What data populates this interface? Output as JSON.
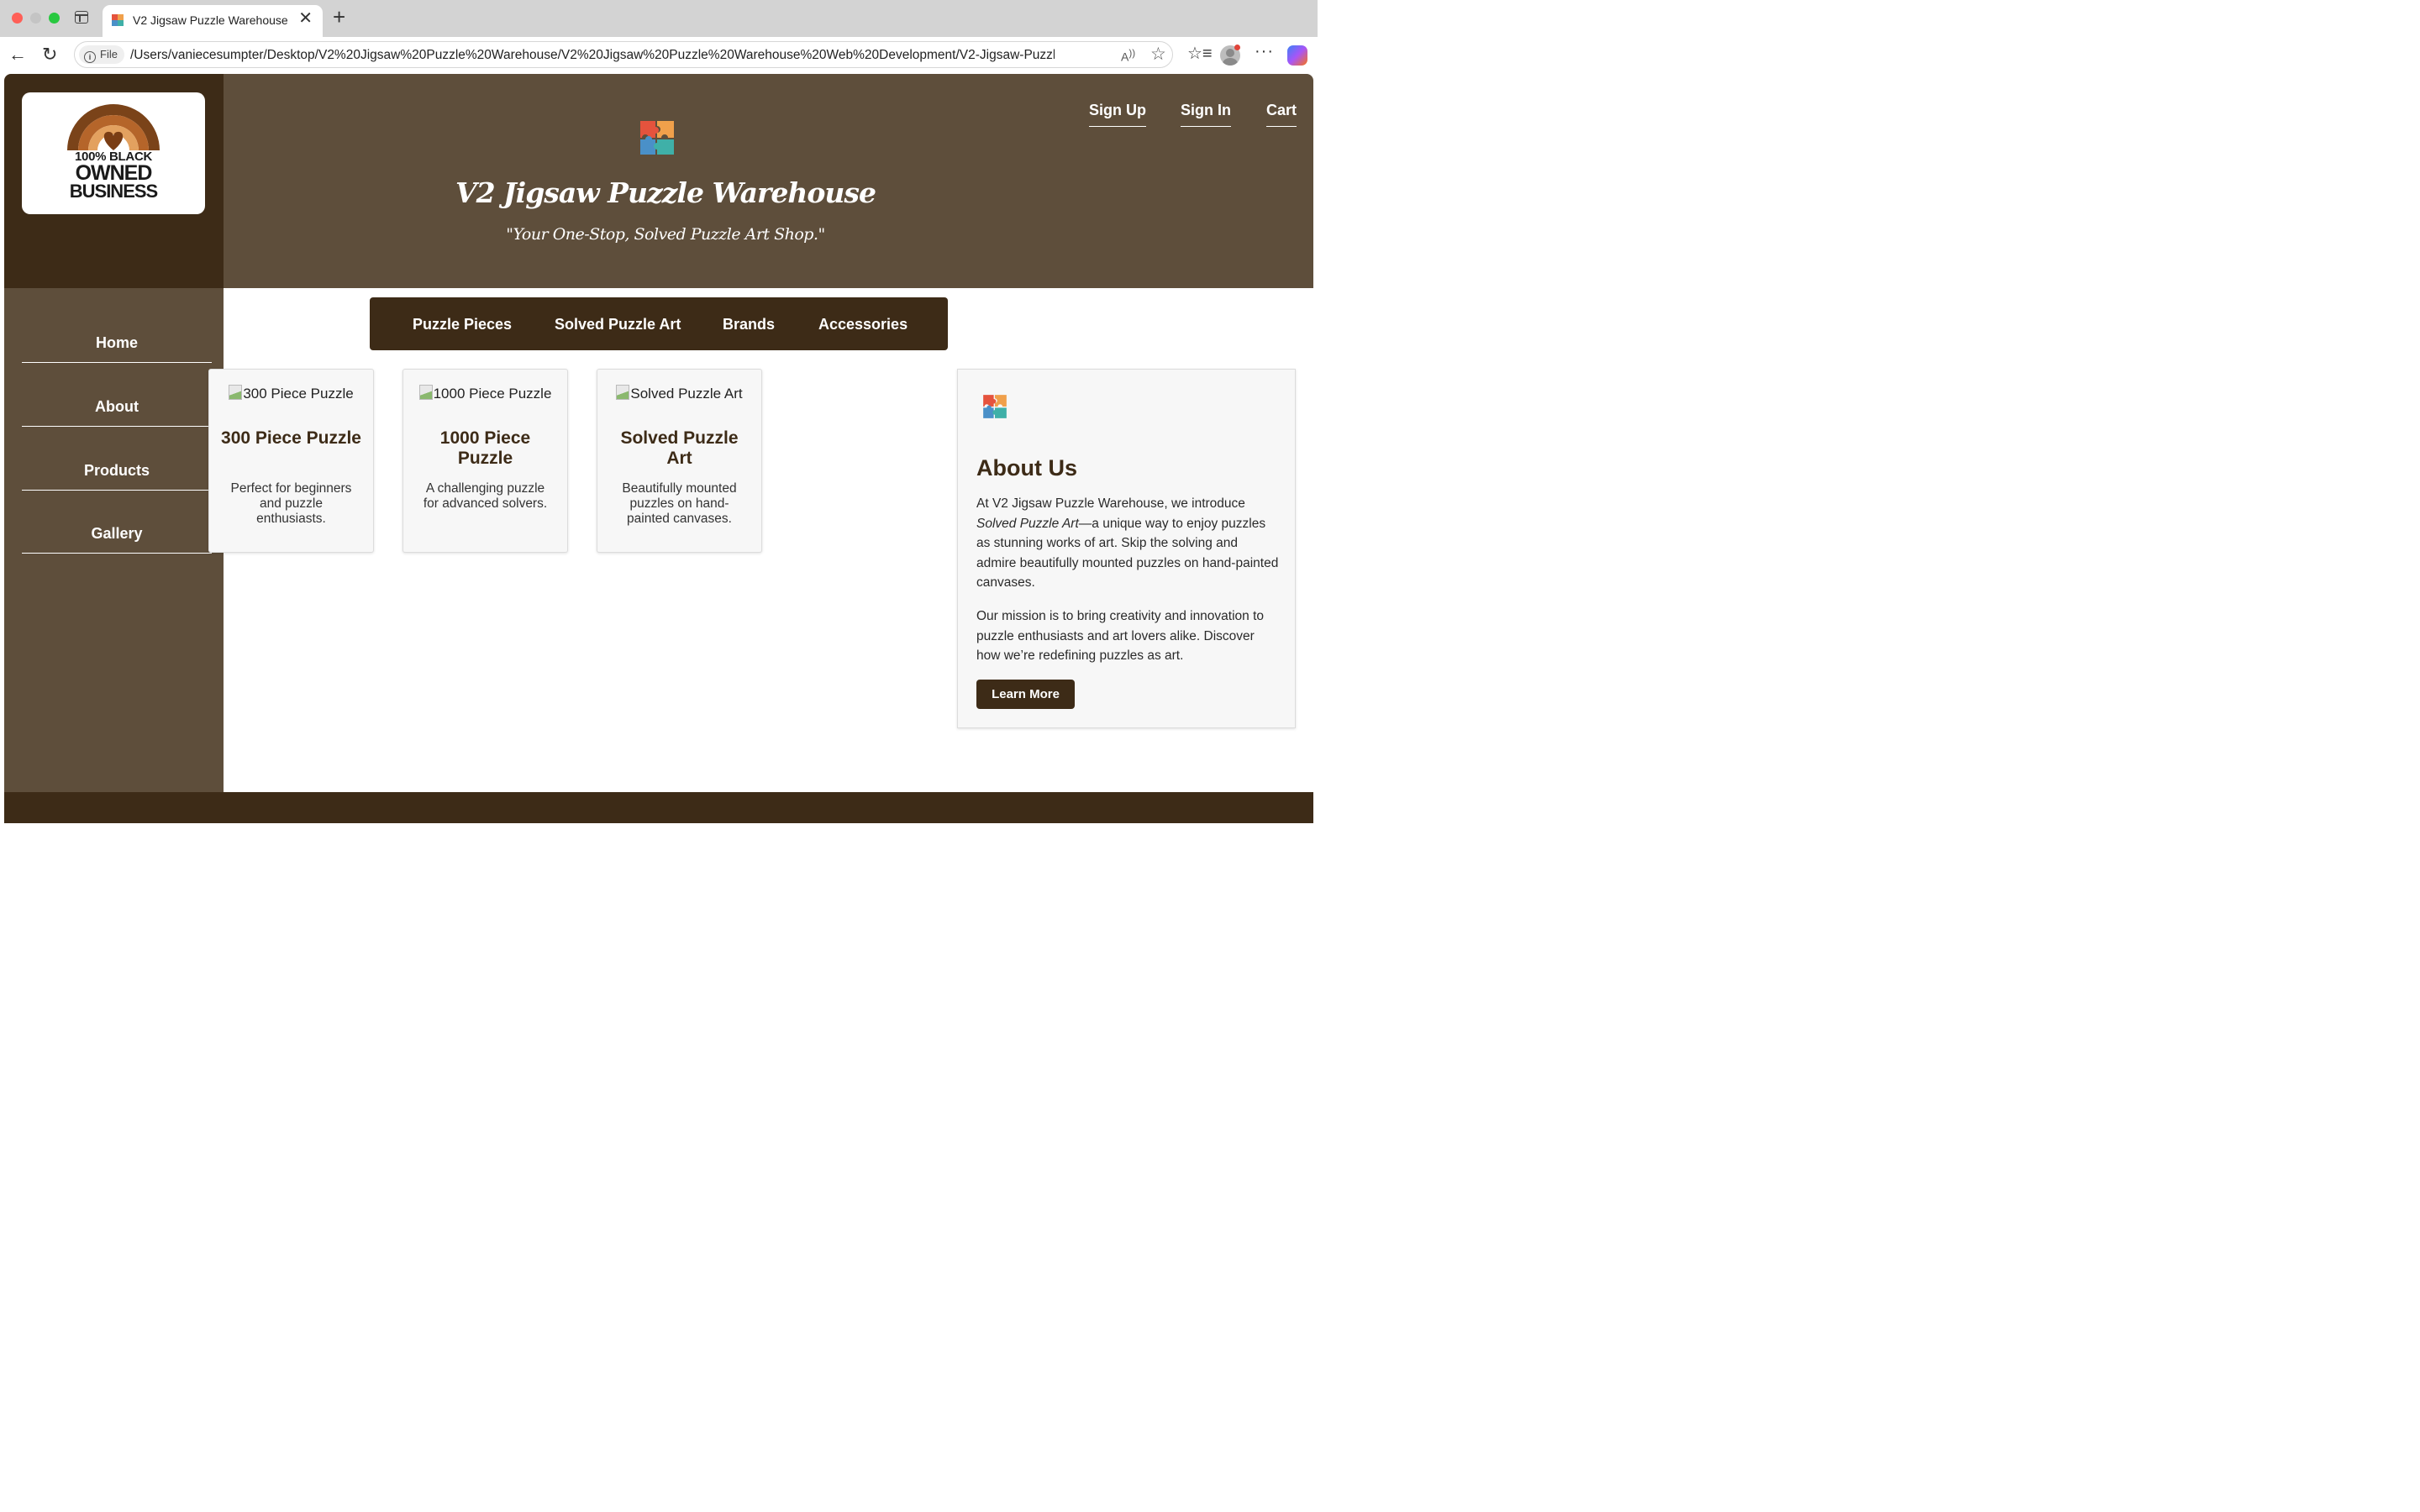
{
  "browser": {
    "tab_title": "V2 Jigsaw Puzzle Warehouse",
    "tab_close": "✕",
    "new_tab": "+",
    "file_chip": "File",
    "url": "/Users/vaniecesumpter/Desktop/V2%20Jigsaw%20Puzzle%20Warehouse/V2%20Jigsaw%20Puzzle%20Warehouse%20Web%20Development/V2-Jigsaw-Puzzl...",
    "icons": [
      "back-icon",
      "reload-icon",
      "info-icon",
      "read-aloud-icon",
      "star-icon",
      "favorites-icon",
      "profile-icon",
      "more-icon",
      "copilot-icon"
    ]
  },
  "logo_badge": {
    "line1": "100% BLACK",
    "line2": "OWNED",
    "line3": "BUSINESS",
    "colors": {
      "arc_outer": "#7a4319",
      "arc_middle": "#b5652a",
      "arc_inner": "#e3a15f",
      "heart": "#7a3d14"
    }
  },
  "header": {
    "title": "V2 Jigsaw Puzzle Warehouse",
    "tagline": "\"Your One-Stop, Solved Puzzle Art Shop.\"",
    "links": {
      "signup": "Sign Up",
      "signin": "Sign In",
      "cart": "Cart"
    }
  },
  "sidebar": {
    "items": [
      {
        "label": "Home"
      },
      {
        "label": "About"
      },
      {
        "label": "Products"
      },
      {
        "label": "Gallery"
      }
    ]
  },
  "category_nav": {
    "items": [
      {
        "label": "Puzzle Pieces"
      },
      {
        "label": "Solved Puzzle Art"
      },
      {
        "label": "Brands"
      },
      {
        "label": "Accessories"
      }
    ]
  },
  "products": [
    {
      "alt": "300 Piece Puzzle",
      "title": "300 Piece Puzzle",
      "description": "Perfect for beginners and puzzle enthusiasts."
    },
    {
      "alt": "1000 Piece Puzzle",
      "title": "1000 Piece Puzzle",
      "description": "A challenging puzzle for advanced solvers."
    },
    {
      "alt": "Solved Puzzle Art",
      "title": "Solved Puzzle Art",
      "description": "Beautifully mounted puzzles on hand-painted canvases."
    }
  ],
  "about": {
    "title": "About Us",
    "p1_before": "At V2 Jigsaw Puzzle Warehouse, we introduce ",
    "p1_emphasis": "Solved Puzzle Art",
    "p1_after": "—a unique way to enjoy puzzles as stunning works of art. Skip the solving and admire beautifully mounted puzzles on hand-painted canvases.",
    "p2": "Our mission is to bring creativity and innovation to puzzle enthusiasts and art lovers alike. Discover how we’re redefining puzzles as art.",
    "button": "Learn More"
  },
  "colors": {
    "dark_brown": "#3d2b17",
    "medium_brown": "#5e4e3b",
    "puzzle_red": "#e5533d",
    "puzzle_orange": "#f0a04b",
    "puzzle_blue": "#4a90c8",
    "puzzle_teal": "#3fb0a8"
  }
}
